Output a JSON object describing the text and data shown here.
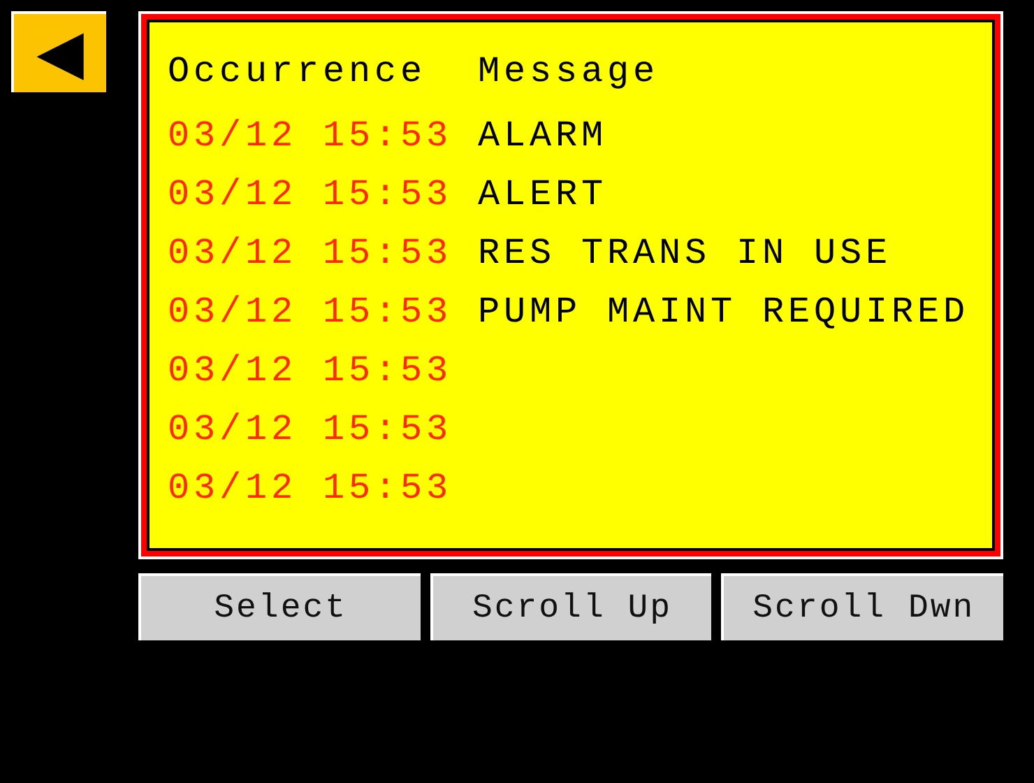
{
  "back_button": {
    "symbol": "◀"
  },
  "alarm_list": {
    "columns": [
      "Occurrence",
      "Message"
    ],
    "rows": [
      {
        "occurrence": "03/12 15:53",
        "message": "ALARM"
      },
      {
        "occurrence": "03/12 15:53",
        "message": "ALERT"
      },
      {
        "occurrence": "03/12 15:53",
        "message": "RES TRANS IN USE"
      },
      {
        "occurrence": "03/12 15:53",
        "message": "PUMP MAINT REQUIRED"
      },
      {
        "occurrence": "03/12 15:53"
      },
      {
        "occurrence": "03/12 15:53"
      },
      {
        "occurrence": "03/12 15:53"
      }
    ]
  },
  "buttons": [
    "Select",
    "Scroll Up",
    "Scroll Dwn"
  ]
}
